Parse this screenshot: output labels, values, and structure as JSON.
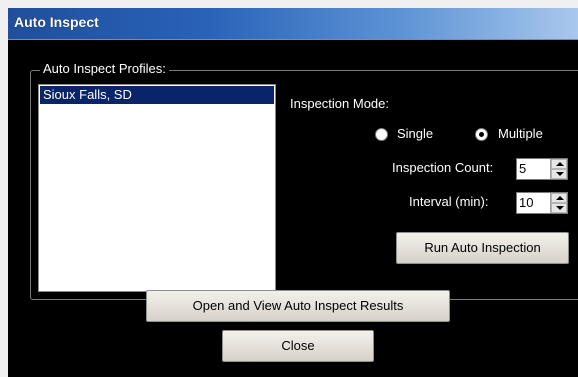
{
  "window": {
    "title": "Auto Inspect"
  },
  "group": {
    "label": "Auto Inspect Profiles:"
  },
  "profiles": [
    "Sioux Falls, SD"
  ],
  "mode": {
    "label": "Inspection Mode:",
    "options": [
      "Single",
      "Multiple"
    ],
    "selected": "Multiple"
  },
  "count": {
    "label": "Inspection Count:",
    "value": "5"
  },
  "interval": {
    "label": "Interval (min):",
    "value": "10"
  },
  "buttons": {
    "run": "Run Auto Inspection",
    "open_results": "Open and View Auto Inspect Results",
    "close": "Close"
  }
}
